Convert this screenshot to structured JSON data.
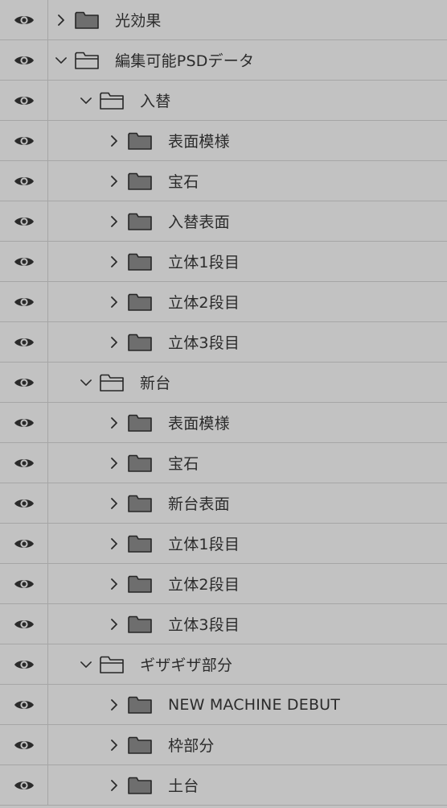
{
  "panel": {
    "title": "",
    "layers": [
      {
        "label": "光効果",
        "depth": 0,
        "expanded": false
      },
      {
        "label": "編集可能PSDデータ",
        "depth": 0,
        "expanded": true
      },
      {
        "label": "入替",
        "depth": 1,
        "expanded": true
      },
      {
        "label": "表面模様",
        "depth": 2,
        "expanded": false
      },
      {
        "label": "宝石",
        "depth": 2,
        "expanded": false
      },
      {
        "label": "入替表面",
        "depth": 2,
        "expanded": false
      },
      {
        "label": "立体1段目",
        "depth": 2,
        "expanded": false
      },
      {
        "label": "立体2段目",
        "depth": 2,
        "expanded": false
      },
      {
        "label": "立体3段目",
        "depth": 2,
        "expanded": false
      },
      {
        "label": "新台",
        "depth": 1,
        "expanded": true
      },
      {
        "label": "表面模様",
        "depth": 2,
        "expanded": false
      },
      {
        "label": "宝石",
        "depth": 2,
        "expanded": false
      },
      {
        "label": "新台表面",
        "depth": 2,
        "expanded": false
      },
      {
        "label": "立体1段目",
        "depth": 2,
        "expanded": false
      },
      {
        "label": "立体2段目",
        "depth": 2,
        "expanded": false
      },
      {
        "label": "立体3段目",
        "depth": 2,
        "expanded": false
      },
      {
        "label": "ギザギザ部分",
        "depth": 1,
        "expanded": true
      },
      {
        "label": "NEW MACHINE DEBUT",
        "depth": 2,
        "expanded": false
      },
      {
        "label": "枠部分",
        "depth": 2,
        "expanded": false
      },
      {
        "label": "土台",
        "depth": 2,
        "expanded": false
      }
    ],
    "icons": {
      "visibility": "eye-icon",
      "collapsed": "chevron-right-icon",
      "expanded": "chevron-down-icon",
      "closed_group": "folder-icon",
      "open_group": "folder-open-icon"
    },
    "colors": {
      "background": "#c2c2c2",
      "divider": "#a6a6a6",
      "text": "#2b2b2b",
      "icon": "#2a2a2a"
    }
  }
}
